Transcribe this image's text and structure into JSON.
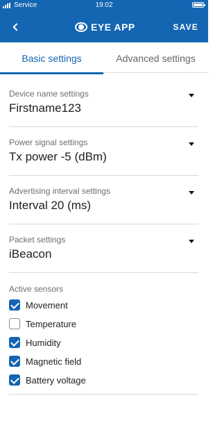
{
  "status_bar": {
    "carrier": "Service",
    "time": "19:02"
  },
  "header": {
    "title": "EYE APP",
    "save_label": "SAVE",
    "icons": {
      "back": "chevron-left-icon",
      "logo": "eye-logo-icon"
    }
  },
  "tabs": [
    {
      "label": "Basic settings",
      "active": true
    },
    {
      "label": "Advanced settings",
      "active": false
    }
  ],
  "settings": [
    {
      "label": "Device name settings",
      "value": "Firstname123"
    },
    {
      "label": "Power signal settings",
      "value": "Tx power -5 (dBm)"
    },
    {
      "label": "Advertising interval settings",
      "value": "Interval 20 (ms)"
    },
    {
      "label": "Packet settings",
      "value": "iBeacon"
    }
  ],
  "sensors": {
    "title": "Active sensors",
    "items": [
      {
        "label": "Movement",
        "checked": true
      },
      {
        "label": "Temperature",
        "checked": false
      },
      {
        "label": "Humidity",
        "checked": true
      },
      {
        "label": "Magnetic field",
        "checked": true
      },
      {
        "label": "Battery voltage",
        "checked": true
      }
    ]
  },
  "colors": {
    "accent": "#1465b2",
    "background": "#ffffff",
    "divider": "#d8d8d8"
  }
}
